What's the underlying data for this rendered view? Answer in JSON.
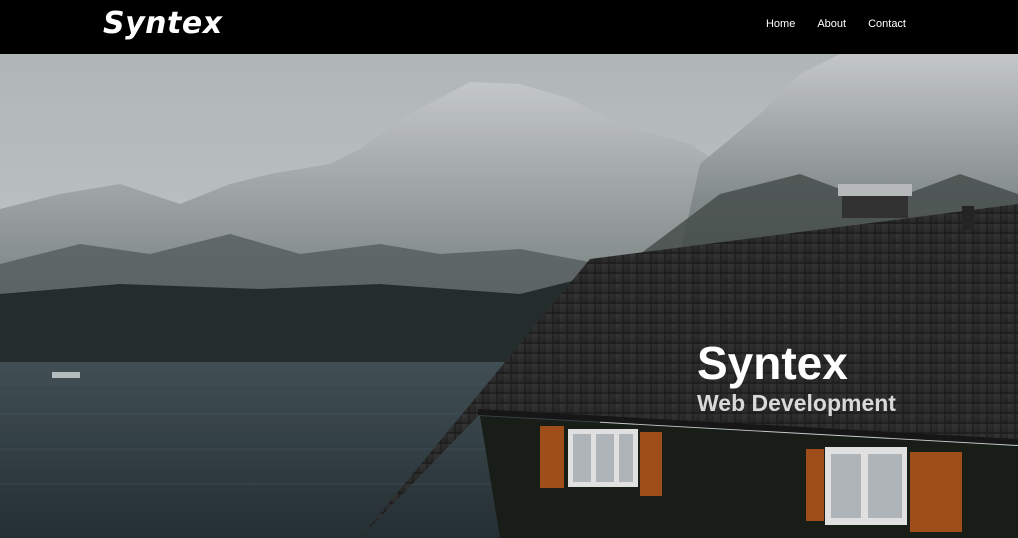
{
  "header": {
    "logo": "Syntex",
    "nav": [
      {
        "label": "Home"
      },
      {
        "label": "About"
      },
      {
        "label": "Contact"
      }
    ]
  },
  "hero": {
    "title": "Syntex",
    "subtitle": "Web Development",
    "image_subject": "snowy mountains above a lake with a house roof in the foreground"
  },
  "colors": {
    "navbar_bg": "#000000",
    "text_primary": "#ffffff",
    "subtitle_text": "#d9d9d9"
  }
}
